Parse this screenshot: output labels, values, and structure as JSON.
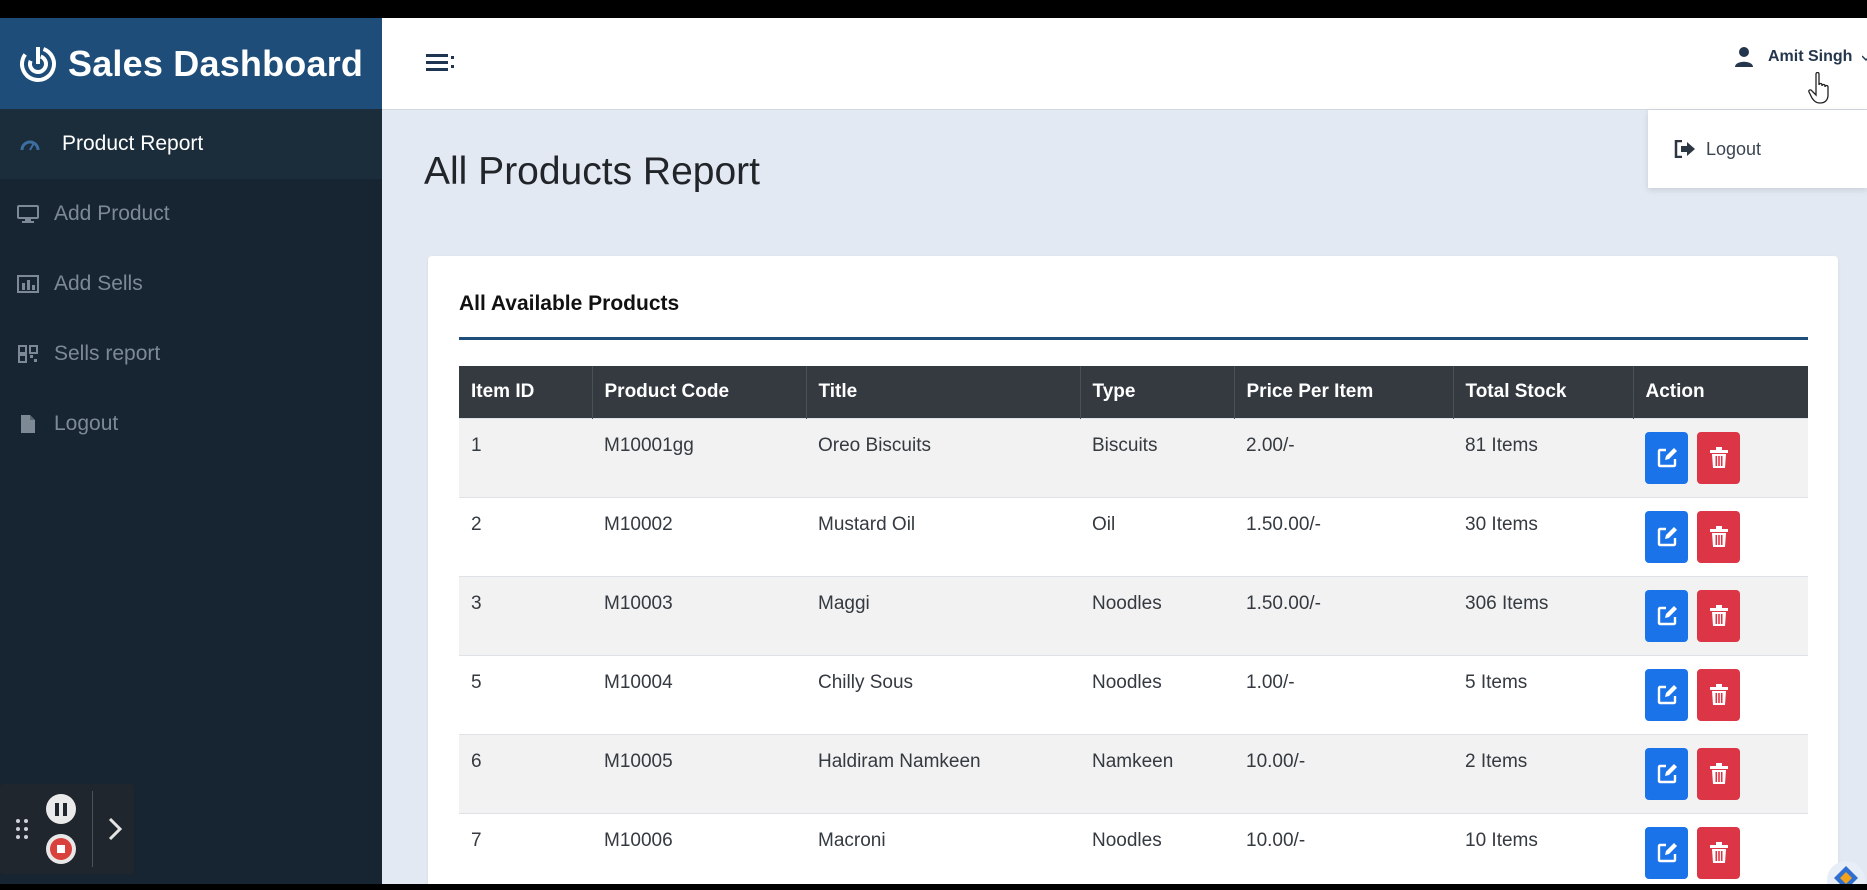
{
  "brand": {
    "title": "Sales Dashboard"
  },
  "sidebar": {
    "items": [
      {
        "label": "Product Report",
        "icon": "dashboard-icon",
        "active": true
      },
      {
        "label": "Add Product",
        "icon": "desktop-icon"
      },
      {
        "label": "Add Sells",
        "icon": "bar-chart-icon"
      },
      {
        "label": "Sells report",
        "icon": "qrcode-icon"
      },
      {
        "label": "Logout",
        "icon": "file-icon"
      }
    ]
  },
  "topbar": {
    "user_name": "Amit Singh",
    "dropdown": {
      "logout_label": "Logout"
    }
  },
  "page": {
    "title": "All Products Report",
    "card_title": "All Available Products"
  },
  "table": {
    "headers": [
      "Item ID",
      "Product Code",
      "Title",
      "Type",
      "Price Per Item",
      "Total Stock",
      "Action"
    ],
    "rows": [
      {
        "id": "1",
        "code": "M10001gg",
        "title": "Oreo Biscuits",
        "type": "Biscuits",
        "price": "2.00/-",
        "stock": "81 Items"
      },
      {
        "id": "2",
        "code": "M10002",
        "title": "Mustard Oil",
        "type": "Oil",
        "price": "1.50.00/-",
        "stock": "30 Items"
      },
      {
        "id": "3",
        "code": "M10003",
        "title": "Maggi",
        "type": "Noodles",
        "price": "1.50.00/-",
        "stock": "306 Items"
      },
      {
        "id": "5",
        "code": "M10004",
        "title": "Chilly Sous",
        "type": "Noodles",
        "price": "1.00/-",
        "stock": "5 Items"
      },
      {
        "id": "6",
        "code": "M10005",
        "title": "Haldiram Namkeen",
        "type": "Namkeen",
        "price": "10.00/-",
        "stock": "2 Items"
      },
      {
        "id": "7",
        "code": "M10006",
        "title": "Macroni",
        "type": "Noodles",
        "price": "10.00/-",
        "stock": "10 Items"
      }
    ]
  },
  "colors": {
    "brand_bar": "#1d4d78",
    "sidebar": "#172431",
    "edit_button": "#1a73e8",
    "delete_button": "#dc3545",
    "table_header": "#343a40"
  }
}
